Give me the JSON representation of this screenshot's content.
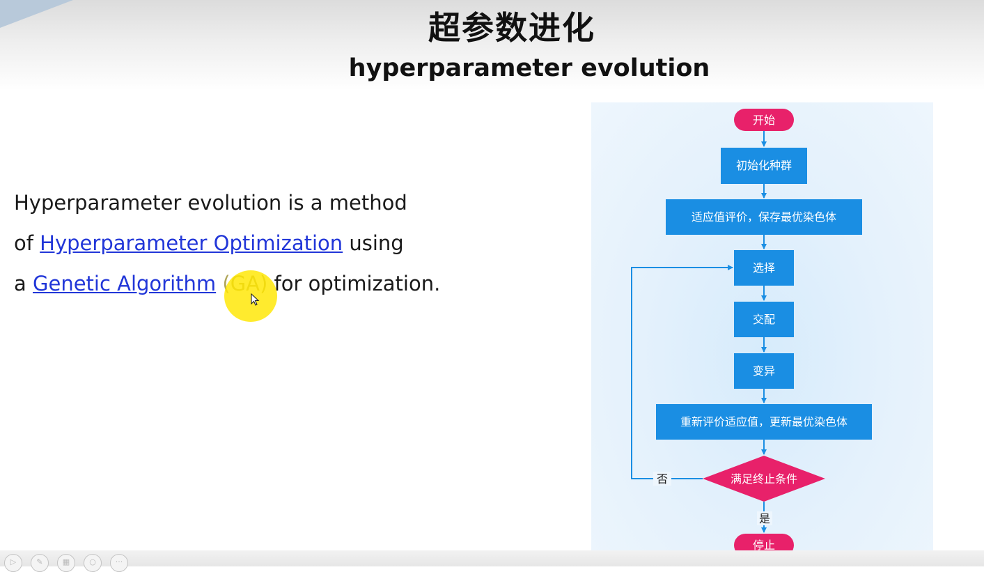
{
  "slide": {
    "title_cn": "超参数进化",
    "title_en": "hyperparameter evolution"
  },
  "paragraph": {
    "line1": "Hyperparameter evolution is a method",
    "line2_prefix": "of ",
    "link_hpo": "Hyperparameter Optimization",
    "line2_suffix": " using",
    "line3_prefix": "a ",
    "link_ga": "Genetic Algorithm",
    "ga_abbr": " (GA)",
    "line3_suffix": " for optimization."
  },
  "flowchart": {
    "start": "开始",
    "init": "初始化种群",
    "fitness": "适应值评价，保存最优染色体",
    "select": "选择",
    "crossover": "交配",
    "mutate": "变异",
    "reeval": "重新评价适应值，更新最优染色体",
    "condition": "满足终止条件",
    "no": "否",
    "yes": "是",
    "stop": "停止",
    "colors": {
      "terminal": "#e8216a",
      "process": "#1a8ee3",
      "line": "#1a8ee3"
    }
  },
  "player_controls": {
    "icons": [
      "play-icon",
      "pen-icon",
      "slides-icon",
      "zoom-icon",
      "more-icon"
    ]
  },
  "colors": {
    "link": "#2136d8",
    "highlight": "#ffe600"
  }
}
